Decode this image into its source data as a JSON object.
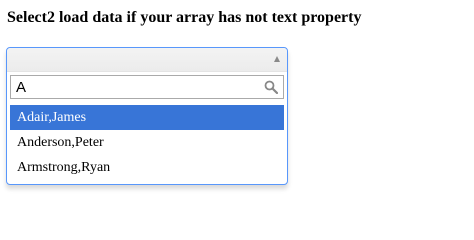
{
  "page": {
    "title": "Select2 load data if your array has not text property"
  },
  "select": {
    "search": {
      "value": "A",
      "icon": "search-icon"
    },
    "arrow_icon": "arrow-up-icon",
    "results": [
      {
        "label": "Adair,James",
        "highlighted": true
      },
      {
        "label": "Anderson,Peter",
        "highlighted": false
      },
      {
        "label": "Armstrong,Ryan",
        "highlighted": false
      }
    ]
  },
  "colors": {
    "highlight": "#3875d7",
    "focus_border": "#5897fb"
  }
}
